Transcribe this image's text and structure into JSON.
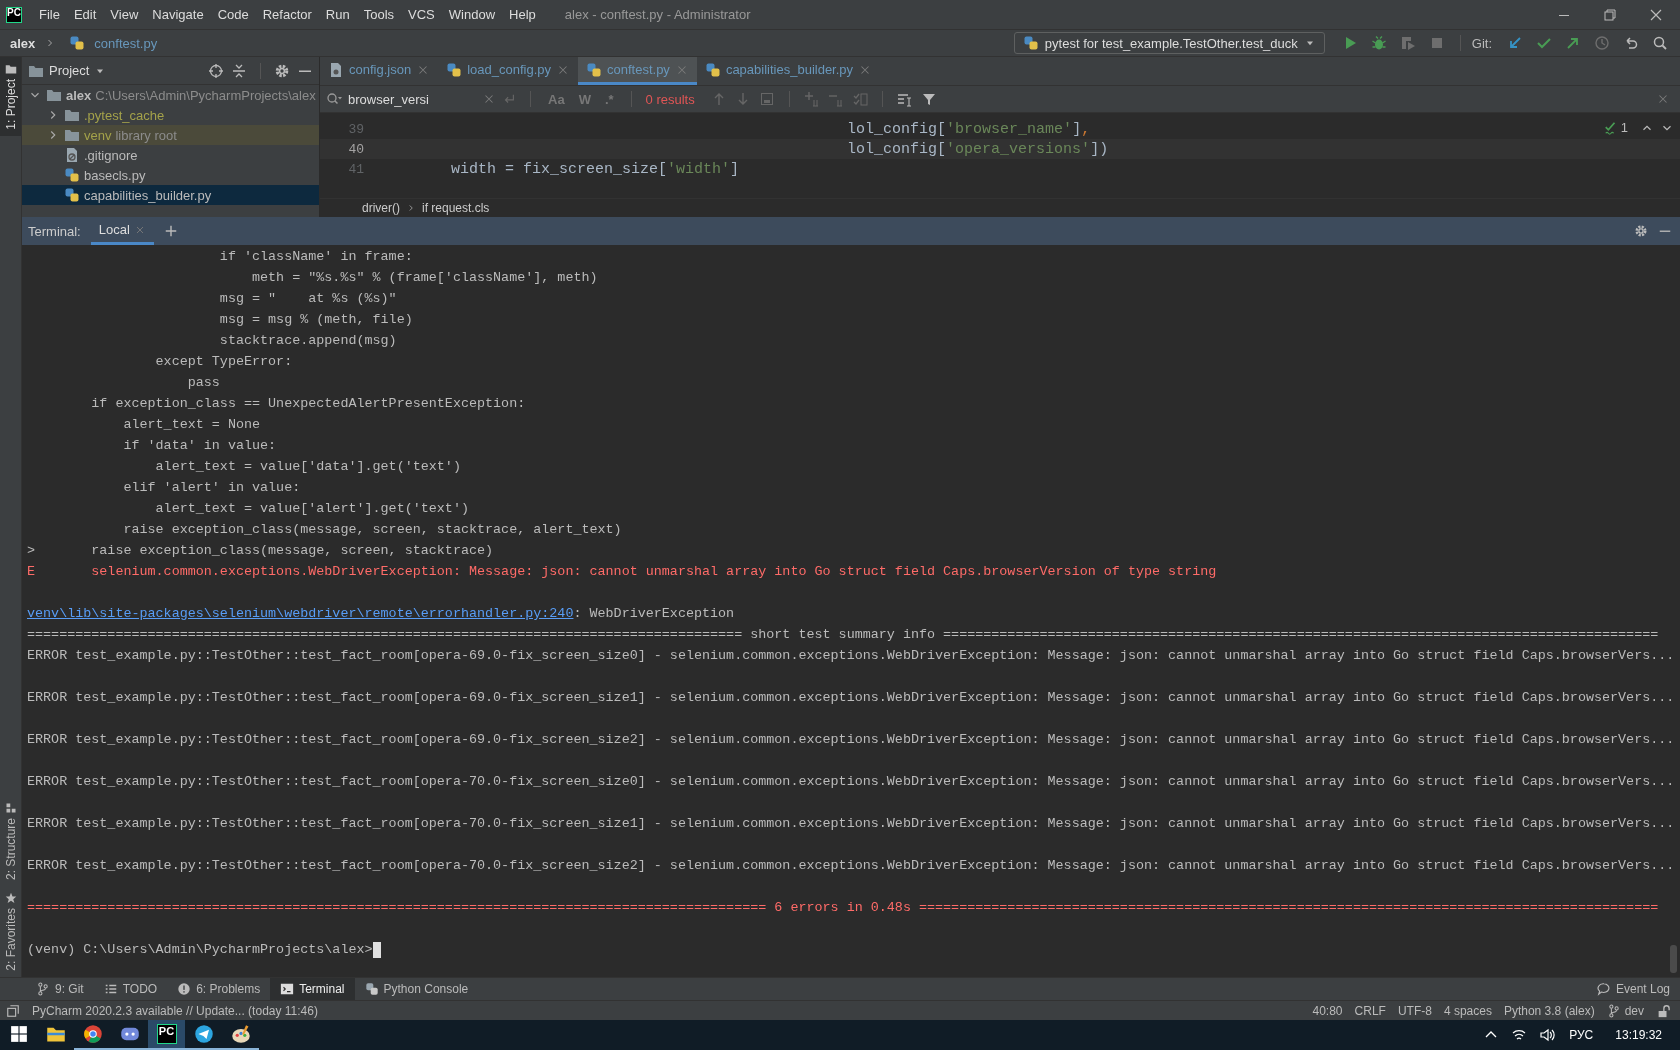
{
  "title_bar": {
    "logo_text": "PC",
    "menu": [
      "File",
      "Edit",
      "View",
      "Navigate",
      "Code",
      "Refactor",
      "Run",
      "Tools",
      "VCS",
      "Window",
      "Help"
    ],
    "title": "alex - conftest.py - Administrator"
  },
  "nav_bar": {
    "breadcrumbs": [
      {
        "label": "alex",
        "kind": "project"
      },
      {
        "label": "conftest.py",
        "kind": "python"
      }
    ],
    "run_config": "pytest for test_example.TestOther.test_duck",
    "git_label": "Git:"
  },
  "tool_strip": {
    "top": [
      {
        "label": "1: Project",
        "selected": true
      }
    ],
    "bottom": [
      {
        "label": "2: Structure",
        "kind": "structure"
      },
      {
        "label": "2: Favorites",
        "kind": "favorites"
      }
    ]
  },
  "project_panel": {
    "title": "Project",
    "tree": [
      {
        "name": "alex",
        "note": "C:\\Users\\Admin\\PycharmProjects\\alex",
        "kind": "folder",
        "expanded": true,
        "selected": false,
        "ignored": false,
        "highlighted": false,
        "children": [
          {
            "name": ".pytest_cache",
            "kind": "folder",
            "expanded": false,
            "selected": false,
            "ignored": true,
            "highlighted": false
          },
          {
            "name": "venv",
            "note": "library root",
            "kind": "folder",
            "expanded": false,
            "selected": false,
            "ignored": true,
            "highlighted": true
          },
          {
            "name": ".gitignore",
            "kind": "gitignore",
            "selected": false,
            "ignored": false,
            "highlighted": false
          },
          {
            "name": "basecls.py",
            "kind": "python",
            "selected": false,
            "ignored": false,
            "highlighted": false
          },
          {
            "name": "capabilities_builder.py",
            "kind": "python",
            "selected": true,
            "ignored": false,
            "highlighted": false
          }
        ]
      }
    ]
  },
  "editor": {
    "tabs": [
      {
        "label": "config.json",
        "kind": "json",
        "selected": false
      },
      {
        "label": "load_config.py",
        "kind": "python",
        "selected": false
      },
      {
        "label": "conftest.py",
        "kind": "python",
        "selected": true
      },
      {
        "label": "capabilities_builder.py",
        "kind": "python",
        "selected": false
      }
    ],
    "search": {
      "value": "browser_versi",
      "options": [
        {
          "label": "Aa",
          "selected": false
        },
        {
          "label": "W",
          "selected": false
        },
        {
          "label": ".*",
          "selected": false
        }
      ],
      "results": "0 results"
    },
    "lines": [
      {
        "number": "39",
        "current": false,
        "tokens": [
          {
            "kind": "plain",
            "text": "                                                    lol_config["
          },
          {
            "kind": "string",
            "text": "'browser_name'"
          },
          {
            "kind": "plain",
            "text": "]"
          },
          {
            "kind": "punct",
            "text": ","
          }
        ]
      },
      {
        "number": "40",
        "current": true,
        "tokens": [
          {
            "kind": "plain",
            "text": "                                                    lol_config["
          },
          {
            "kind": "string",
            "text": "'opera_versions'"
          },
          {
            "kind": "plain",
            "text": "])"
          }
        ]
      },
      {
        "number": "41",
        "current": false,
        "tokens": [
          {
            "kind": "plain",
            "text": "        width = fix_screen_size["
          },
          {
            "kind": "string",
            "text": "'width'"
          },
          {
            "kind": "plain",
            "text": "]"
          }
        ]
      }
    ],
    "inspection_count": "1",
    "breadcrumbs": [
      "driver()",
      "if request.cls"
    ]
  },
  "terminal": {
    "label": "Terminal:",
    "tabs": [
      {
        "label": "Local",
        "selected": true
      }
    ],
    "lines": [
      {
        "kind": "code",
        "text": "                        if 'className' in frame:"
      },
      {
        "kind": "code",
        "text": "                            meth = \"%s.%s\" % (frame['className'], meth)"
      },
      {
        "kind": "code",
        "text": "                        msg = \"    at %s (%s)\""
      },
      {
        "kind": "code",
        "text": "                        msg = msg % (meth, file)"
      },
      {
        "kind": "code",
        "text": "                        stacktrace.append(msg)"
      },
      {
        "kind": "code",
        "text": "                except TypeError:"
      },
      {
        "kind": "code",
        "text": "                    pass"
      },
      {
        "kind": "code",
        "text": "        if exception_class == UnexpectedAlertPresentException:"
      },
      {
        "kind": "code",
        "text": "            alert_text = None"
      },
      {
        "kind": "code",
        "text": "            if 'data' in value:"
      },
      {
        "kind": "code",
        "text": "                alert_text = value['data'].get('text')"
      },
      {
        "kind": "code",
        "text": "            elif 'alert' in value:"
      },
      {
        "kind": "code",
        "text": "                alert_text = value['alert'].get('text')"
      },
      {
        "kind": "code",
        "text": "            raise exception_class(message, screen, stacktrace, alert_text)"
      },
      {
        "kind": "code",
        "text": ">       raise exception_class(message, screen, stacktrace)"
      },
      {
        "kind": "error",
        "text": "E       selenium.common.exceptions.WebDriverException: Message: json: cannot unmarshal array into Go struct field Caps.browserVersion of type string"
      },
      {
        "kind": "blank"
      },
      {
        "kind": "link",
        "link": "venv\\lib\\site-packages\\selenium\\webdriver\\remote\\errorhandler.py:240",
        "text": ": WebDriverException"
      },
      {
        "kind": "rule",
        "text": "========================================================================================= short test summary info ========================================================================================="
      },
      {
        "kind": "plain",
        "text": "ERROR test_example.py::TestOther::test_fact_room[opera-69.0-fix_screen_size0] - selenium.common.exceptions.WebDriverException: Message: json: cannot unmarshal array into Go struct field Caps.browserVers..."
      },
      {
        "kind": "blank"
      },
      {
        "kind": "plain",
        "text": "ERROR test_example.py::TestOther::test_fact_room[opera-69.0-fix_screen_size1] - selenium.common.exceptions.WebDriverException: Message: json: cannot unmarshal array into Go struct field Caps.browserVers..."
      },
      {
        "kind": "blank"
      },
      {
        "kind": "plain",
        "text": "ERROR test_example.py::TestOther::test_fact_room[opera-69.0-fix_screen_size2] - selenium.common.exceptions.WebDriverException: Message: json: cannot unmarshal array into Go struct field Caps.browserVers..."
      },
      {
        "kind": "blank"
      },
      {
        "kind": "plain",
        "text": "ERROR test_example.py::TestOther::test_fact_room[opera-70.0-fix_screen_size0] - selenium.common.exceptions.WebDriverException: Message: json: cannot unmarshal array into Go struct field Caps.browserVers..."
      },
      {
        "kind": "blank"
      },
      {
        "kind": "plain",
        "text": "ERROR test_example.py::TestOther::test_fact_room[opera-70.0-fix_screen_size1] - selenium.common.exceptions.WebDriverException: Message: json: cannot unmarshal array into Go struct field Caps.browserVers..."
      },
      {
        "kind": "blank"
      },
      {
        "kind": "plain",
        "text": "ERROR test_example.py::TestOther::test_fact_room[opera-70.0-fix_screen_size2] - selenium.common.exceptions.WebDriverException: Message: json: cannot unmarshal array into Go struct field Caps.browserVers..."
      },
      {
        "kind": "blank"
      },
      {
        "kind": "fail_rule",
        "text": "============================================================================================ 6 errors in 0.48s ============================================================================================"
      },
      {
        "kind": "blank"
      },
      {
        "kind": "prompt",
        "text": "(venv) C:\\Users\\Admin\\PycharmProjects\\alex>"
      }
    ]
  },
  "tool_tabs": [
    {
      "label": "9: Git",
      "kind": "git",
      "selected": false
    },
    {
      "label": "TODO",
      "kind": "todo",
      "selected": false
    },
    {
      "label": "6: Problems",
      "kind": "problems",
      "selected": false
    },
    {
      "label": "Terminal",
      "kind": "terminal",
      "selected": true
    },
    {
      "label": "Python Console",
      "kind": "console",
      "selected": false
    }
  ],
  "event_log": "Event Log",
  "status_bar": {
    "message": "PyCharm 2020.2.3 available // Update... (today 11:46)",
    "items": [
      "40:80",
      "CRLF",
      "UTF-8",
      "4 spaces",
      "Python 3.8 (alex)"
    ],
    "branch": "dev"
  },
  "taskbar": {
    "apps": [
      {
        "kind": "explorer",
        "running": false,
        "selected": false
      },
      {
        "kind": "browser",
        "running": true,
        "selected": false
      },
      {
        "kind": "chat",
        "running": true,
        "selected": false
      },
      {
        "kind": "pycharm",
        "label": "PC",
        "running": true,
        "selected": true
      },
      {
        "kind": "telegram",
        "running": true,
        "selected": false
      },
      {
        "kind": "paint",
        "running": true,
        "selected": false
      }
    ],
    "language": "РУС",
    "time": "13:19:32"
  }
}
